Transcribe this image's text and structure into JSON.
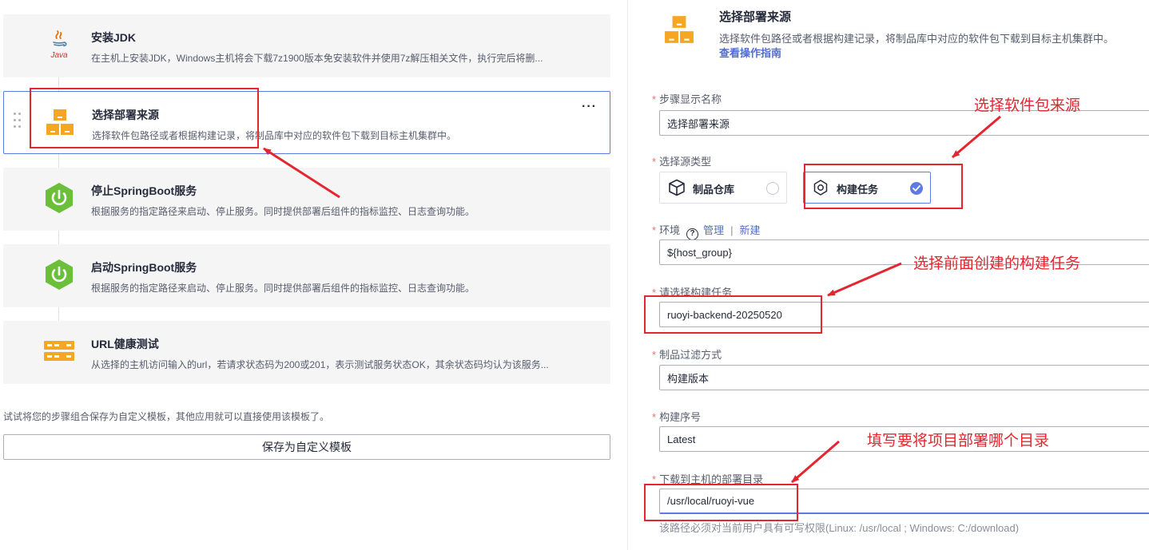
{
  "steps": [
    {
      "title": "安装JDK",
      "desc": "在主机上安装JDK，Windows主机将会下载7z1900版本免安装软件并使用7z解压相关文件，执行完后将删...",
      "icon": "java-icon"
    },
    {
      "title": "选择部署来源",
      "desc": "选择软件包路径或者根据构建记录，将制品库中对应的软件包下载到目标主机集群中。",
      "icon": "deploy-source-icon",
      "more": "···"
    },
    {
      "title": "停止SpringBoot服务",
      "desc": "根据服务的指定路径来启动、停止服务。同时提供部署后组件的指标监控、日志查询功能。",
      "icon": "springboot-icon"
    },
    {
      "title": "启动SpringBoot服务",
      "desc": "根据服务的指定路径来启动、停止服务。同时提供部署后组件的指标监控、日志查询功能。",
      "icon": "springboot-icon"
    },
    {
      "title": "URL健康测试",
      "desc": "从选择的主机访问输入的url，若请求状态码为200或201，表示测试服务状态OK，其余状态码均认为该服务...",
      "icon": "url-health-icon"
    }
  ],
  "template_tip": "试试将您的步骤组合保存为自定义模板，其他应用就可以直接使用该模板了。",
  "save_template_label": "保存为自定义模板",
  "form": {
    "header": {
      "title": "选择部署来源",
      "desc": "选择软件包路径或者根据构建记录，将制品库中对应的软件包下载到目标主机集群中。",
      "guide_link": "查看操作指南"
    },
    "step_name": {
      "label": "步骤显示名称",
      "value": "选择部署来源"
    },
    "source_type": {
      "label": "选择源类型",
      "options": [
        {
          "label": "制品仓库",
          "selected": false
        },
        {
          "label": "构建任务",
          "selected": true
        }
      ]
    },
    "env": {
      "label": "环境",
      "help": "?",
      "manage": "管理",
      "sep": "|",
      "new": "新建",
      "value": "${host_group}"
    },
    "build_task": {
      "label": "请选择构建任务",
      "value": "ruoyi-backend-20250520"
    },
    "filter": {
      "label": "制品过滤方式",
      "value": "构建版本"
    },
    "build_no": {
      "label": "构建序号",
      "value": "Latest"
    },
    "deploy_dir": {
      "label": "下载到主机的部署目录",
      "value": "/usr/local/ruoyi-vue",
      "hint": "该路径必须对当前用户具有可写权限(Linux: /usr/local ; Windows: C:/download)"
    },
    "required_mark": "*"
  },
  "annotations": {
    "pick_source": "选择软件包来源",
    "pick_build": "选择前面创建的构建任务",
    "fill_dir": "填写要将项目部署哪个目录"
  },
  "colors": {
    "accent": "#5e7ce0",
    "link": "#526ecc",
    "annotation": "#e3262f",
    "icon_orange": "#f5a623",
    "spring_green": "#6cbf3b"
  }
}
